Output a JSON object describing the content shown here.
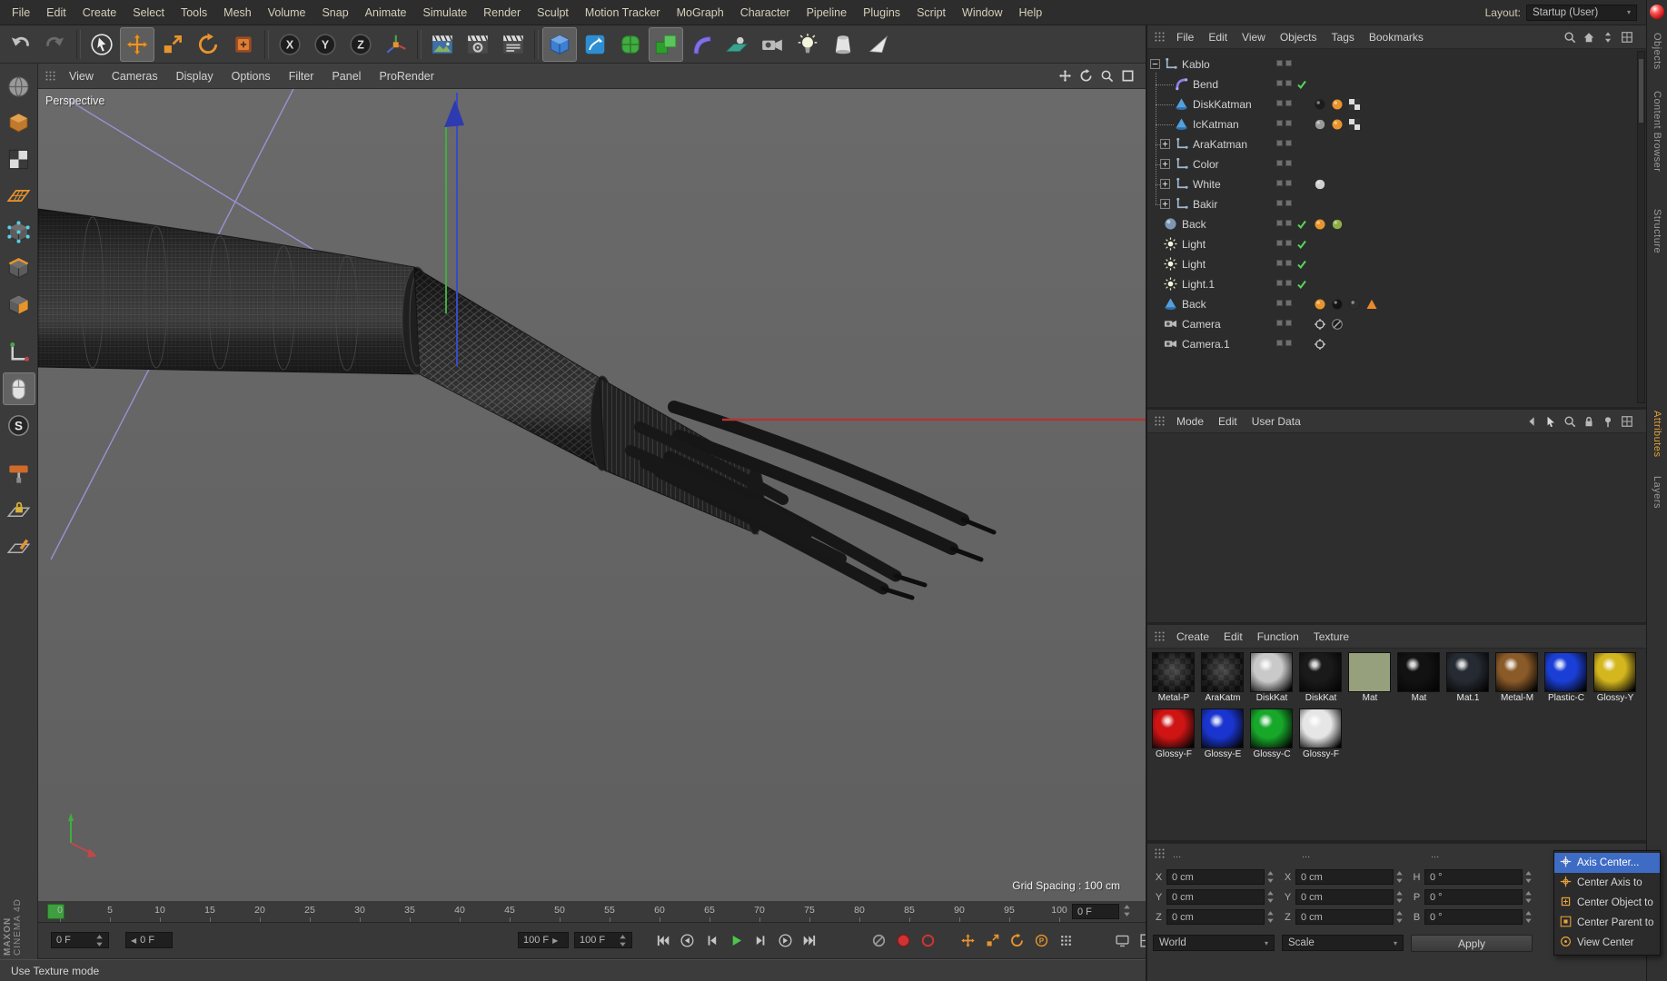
{
  "menubar": {
    "items": [
      "File",
      "Edit",
      "Create",
      "Select",
      "Tools",
      "Mesh",
      "Volume",
      "Snap",
      "Animate",
      "Simulate",
      "Render",
      "Sculpt",
      "Motion Tracker",
      "MoGraph",
      "Character",
      "Pipeline",
      "Plugins",
      "Script",
      "Window",
      "Help"
    ],
    "layout_label": "Layout:",
    "layout_value": "Startup (User)"
  },
  "toolbar": {
    "buttons": [
      {
        "icon": "undo-icon"
      },
      {
        "icon": "redo-icon"
      },
      {
        "sep": 1
      },
      {
        "icon": "live-selection-icon"
      },
      {
        "icon": "move-icon",
        "hl": 1
      },
      {
        "icon": "scale-icon"
      },
      {
        "icon": "rotate-icon"
      },
      {
        "icon": "last-tool-icon"
      },
      {
        "sep": 1
      },
      {
        "icon": "lock-x-icon"
      },
      {
        "icon": "lock-y-icon"
      },
      {
        "icon": "lock-z-icon"
      },
      {
        "icon": "coord-system-icon"
      },
      {
        "sep": 1
      },
      {
        "icon": "render-view-icon"
      },
      {
        "icon": "render-settings-icon"
      },
      {
        "icon": "render-queue-icon"
      },
      {
        "sep": 1
      },
      {
        "icon": "primitive-cube-icon",
        "hl": 1
      },
      {
        "icon": "spline-pen-icon"
      },
      {
        "icon": "subdivision-icon"
      },
      {
        "icon": "mograph-icon",
        "hl": 1
      },
      {
        "icon": "deformer-icon"
      },
      {
        "icon": "floor-icon"
      },
      {
        "icon": "camera-tool-icon"
      },
      {
        "icon": "light-tool-icon"
      },
      {
        "icon": "stage-icon"
      },
      {
        "icon": "environment-icon"
      }
    ]
  },
  "sidebar": {
    "buttons": [
      {
        "icon": "convert-globe-icon"
      },
      {
        "icon": "model-mode-icon"
      },
      {
        "icon": "texture-mode-icon"
      },
      {
        "icon": "workplane-mode-icon"
      },
      {
        "icon": "points-mode-icon"
      },
      {
        "icon": "edges-mode-icon"
      },
      {
        "icon": "polygons-mode-icon"
      },
      {
        "gap": 1
      },
      {
        "icon": "axis-mode-icon"
      },
      {
        "icon": "mouse-icon",
        "hl": 1
      },
      {
        "icon": "snap-icon"
      },
      {
        "gap": 1
      },
      {
        "icon": "paint-tool-icon"
      },
      {
        "icon": "lock-workplane-icon"
      },
      {
        "icon": "edit-workplane-icon"
      }
    ]
  },
  "viewport": {
    "menu": [
      "View",
      "Cameras",
      "Display",
      "Options",
      "Filter",
      "Panel",
      "ProRender"
    ],
    "view_label": "Perspective",
    "grid_spacing": "Grid Spacing : 100 cm",
    "corner_icons": [
      "pan-view-icon",
      "orbit-view-icon",
      "zoom-view-icon",
      "maximize-view-icon"
    ]
  },
  "object_manager": {
    "menu": [
      "File",
      "Edit",
      "View",
      "Objects",
      "Tags",
      "Bookmarks"
    ],
    "toolbar_icons": [
      "search-icon",
      "home-icon",
      "scroll-arrows-icon",
      "panel-grid-icon"
    ],
    "objects": [
      {
        "name": "Kablo",
        "depth": 0,
        "expander": "minus",
        "icon": "null-icon",
        "tags": []
      },
      {
        "name": "Bend",
        "depth": 1,
        "icon": "bend-icon",
        "check": true,
        "tags": []
      },
      {
        "name": "DiskKatman",
        "depth": 1,
        "icon": "sweep-icon",
        "tags": [
          "sphere:#1c1c1c",
          "phong",
          "checker"
        ]
      },
      {
        "name": "IcKatman",
        "depth": 1,
        "icon": "sweep-icon",
        "tags": [
          "sphere:#9a9a9a",
          "phong",
          "checker"
        ]
      },
      {
        "name": "AraKatman",
        "depth": 1,
        "expander": "plus",
        "icon": "null-icon",
        "tags": []
      },
      {
        "name": "Color",
        "depth": 1,
        "expander": "plus",
        "icon": "null-icon",
        "tags": []
      },
      {
        "name": "White",
        "depth": 1,
        "expander": "plus",
        "icon": "null-icon",
        "tags": [
          "sphere:#d0d0d0"
        ]
      },
      {
        "name": "Bakir",
        "depth": 1,
        "expander": "plus",
        "icon": "null-icon",
        "tags": []
      },
      {
        "name": "Back",
        "depth": 0,
        "icon": "sphere-icon",
        "check": true,
        "tags": [
          "phong",
          "sphere:#8fae4a"
        ]
      },
      {
        "name": "Light",
        "depth": 0,
        "icon": "light-icon",
        "check": true,
        "tags": []
      },
      {
        "name": "Light",
        "depth": 0,
        "icon": "light-icon",
        "check": true,
        "tags": []
      },
      {
        "name": "Light.1",
        "depth": 0,
        "icon": "light-icon",
        "check": true,
        "tags": []
      },
      {
        "name": "Back",
        "depth": 0,
        "icon": "sweep-icon",
        "tags": [
          "phong",
          "sphere:#141414",
          "sphere:#2e2e2e",
          "triangle"
        ]
      },
      {
        "name": "Camera",
        "depth": 0,
        "icon": "camera-icon",
        "tags": [
          "target",
          "protection"
        ]
      },
      {
        "name": "Camera.1",
        "depth": 0,
        "icon": "camera-icon",
        "tags": [
          "target"
        ]
      }
    ]
  },
  "attribute_manager": {
    "menu": [
      "Mode",
      "Edit",
      "User Data"
    ],
    "toolbar_icons": [
      "back-arrow-icon",
      "pointer-arrow-icon",
      "search-icon",
      "lock-icon",
      "pin-icon",
      "panel-grid-icon"
    ]
  },
  "material_manager": {
    "menu": [
      "Create",
      "Edit",
      "Function",
      "Texture"
    ],
    "materials": [
      {
        "name": "Metal-P",
        "swatch": "checker"
      },
      {
        "name": "AraKatm",
        "swatch": "checker"
      },
      {
        "name": "DiskKat",
        "swatch": "sphere",
        "color": "#c9c9c9"
      },
      {
        "name": "DiskKat",
        "swatch": "sphere",
        "color": "#1a1a1a"
      },
      {
        "name": "Mat",
        "swatch": "flat",
        "color": "#97a07c"
      },
      {
        "name": "Mat",
        "swatch": "sphere",
        "color": "#121212"
      },
      {
        "name": "Mat.1",
        "swatch": "sphere",
        "color": "#262b33"
      },
      {
        "name": "Metal-M",
        "swatch": "sphere",
        "color": "#8a5a28"
      },
      {
        "name": "Plastic-C",
        "swatch": "sphere",
        "color": "#1b3fd6"
      },
      {
        "name": "Glossy-Y",
        "swatch": "sphere",
        "color": "#d4b61e"
      },
      {
        "name": "Glossy-F",
        "swatch": "sphere",
        "color": "#cf1414"
      },
      {
        "name": "Glossy-E",
        "swatch": "sphere",
        "color": "#1a35cf"
      },
      {
        "name": "Glossy-C",
        "swatch": "sphere",
        "color": "#17a82a"
      },
      {
        "name": "Glossy-F",
        "swatch": "sphere",
        "color": "#e6e6e6"
      }
    ]
  },
  "coordinate_manager": {
    "columns": [
      {
        "header": "...",
        "rows": [
          [
            "X",
            "0 cm"
          ],
          [
            "Y",
            "0 cm"
          ],
          [
            "Z",
            "0 cm"
          ]
        ]
      },
      {
        "header": "...",
        "rows": [
          [
            "X",
            "0 cm"
          ],
          [
            "Y",
            "0 cm"
          ],
          [
            "Z",
            "0 cm"
          ]
        ]
      },
      {
        "header": "...",
        "rows": [
          [
            "H",
            "0 °"
          ],
          [
            "P",
            "0 °"
          ],
          [
            "B",
            "0 °"
          ]
        ]
      }
    ],
    "dropdowns": [
      "World",
      "Scale"
    ],
    "apply_label": "Apply"
  },
  "context_menu": {
    "items": [
      {
        "label": "Axis Center...",
        "icon": "axis-center-icon",
        "selected": true
      },
      {
        "label": "Center Axis to",
        "icon": "center-axis-icon"
      },
      {
        "label": "Center Object to",
        "icon": "center-object-icon"
      },
      {
        "label": "Center Parent to",
        "icon": "center-parent-icon"
      },
      {
        "label": "View Center",
        "icon": "view-center-icon"
      }
    ]
  },
  "timeline": {
    "ticks": [
      "0",
      "5",
      "10",
      "15",
      "20",
      "25",
      "30",
      "35",
      "40",
      "45",
      "50",
      "55",
      "60",
      "65",
      "70",
      "75",
      "80",
      "85",
      "90",
      "95",
      "100"
    ],
    "ruler_field": "0 F",
    "start_field": "0 F",
    "marker_field": "0 F",
    "end_marker_field": "100 F",
    "end_field": "100 F",
    "transport": [
      "goto-start-icon",
      "prev-key-icon",
      "prev-frame-icon",
      "play-icon",
      "next-frame-icon",
      "next-key-icon",
      "goto-end-icon"
    ],
    "record": [
      "record-off-icon",
      "record-icon",
      "autokey-icon"
    ],
    "keying": [
      "key-position-icon",
      "key-scale-icon",
      "key-rotation-icon",
      "key-parameter-icon",
      "key-pla-icon"
    ],
    "extra": [
      "hud-icon",
      "panel-grid-icon"
    ],
    "status": "Use Texture mode"
  },
  "right_strip": {
    "tabs": [
      {
        "label": "Objects"
      },
      {
        "label": "Content Browser"
      },
      {
        "label": "Structure"
      },
      {
        "label": "Attributes",
        "active": true
      },
      {
        "label": "Layers"
      }
    ]
  },
  "branding": {
    "line1": "MAXON",
    "line2": "CINEMA 4D"
  }
}
